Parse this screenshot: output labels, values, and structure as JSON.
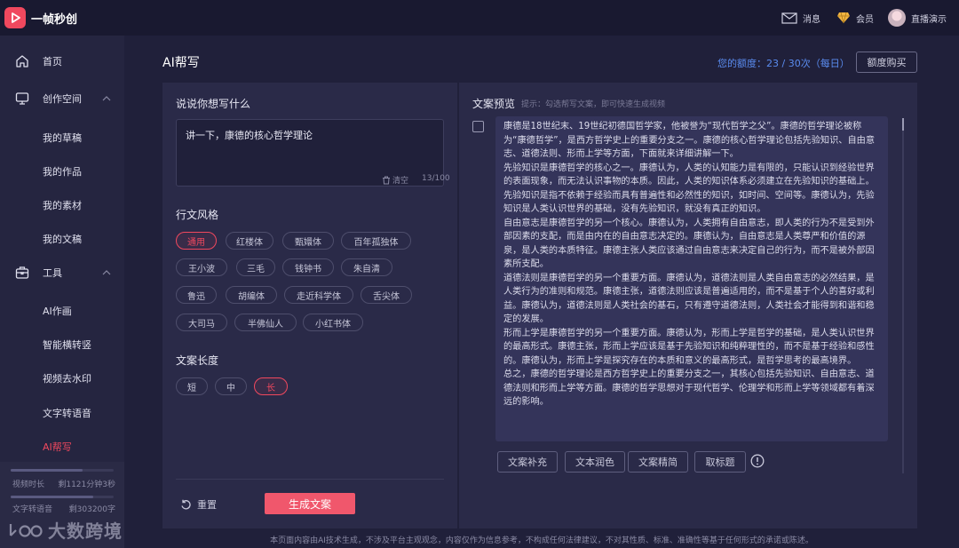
{
  "app": {
    "name": "一帧秒创"
  },
  "topbar": {
    "messages_label": "消息",
    "member_label": "会员",
    "user_name": "直播演示"
  },
  "sidebar": {
    "home": "首页",
    "creation_space": "创作空间",
    "creation_items": [
      "我的草稿",
      "我的作品",
      "我的素材",
      "我的文稿"
    ],
    "tools": "工具",
    "tool_items": [
      "AI作画",
      "智能横转竖",
      "视频去水印",
      "文字转语音",
      "AI帮写"
    ],
    "stats": [
      {
        "label": "视频时长",
        "value": "剩1121分钟3秒"
      },
      {
        "label": "文字转语音",
        "value": "剩303200字"
      }
    ]
  },
  "page": {
    "title": "AI帮写",
    "quota": "您的额度：23 / 30次（每日）",
    "buy_button": "额度购买"
  },
  "form": {
    "prompt_label": "说说你想写什么",
    "prompt_value": "讲一下，康德的核心哲学理论",
    "clear_label": "清空",
    "counter": "13/100",
    "style_label": "行文风格",
    "styles": [
      [
        "通用",
        "红楼体",
        "甄嬛体",
        "百年孤独体"
      ],
      [
        "王小波",
        "三毛",
        "钱钟书",
        "朱自清"
      ],
      [
        "鲁迅",
        "胡编体",
        "走近科学体",
        "舌尖体"
      ],
      [
        "大司马",
        "半佛仙人",
        "小红书体"
      ]
    ],
    "active_style": "通用",
    "length_label": "文案长度",
    "lengths": [
      "短",
      "中",
      "长"
    ],
    "active_length": "长",
    "reset_button": "重置",
    "generate_button": "生成文案"
  },
  "preview": {
    "title": "文案预览",
    "hint": "提示：勾选帮写文案，即可快速生成视频",
    "content": "康德是18世纪末、19世纪初德国哲学家，他被誉为“现代哲学之父”。康德的哲学理论被称为“康德哲学”，是西方哲学史上的重要分支之一。康德的核心哲学理论包括先验知识、自由意志、道德法则、形而上学等方面，下面就来详细讲解一下。\n先验知识是康德哲学的核心之一。康德认为，人类的认知能力是有限的，只能认识到经验世界的表面现象，而无法认识事物的本质。因此，人类的知识体系必须建立在先验知识的基础上。先验知识是指不依赖于经验而具有普遍性和必然性的知识，如时间、空间等。康德认为，先验知识是人类认识世界的基础，没有先验知识，就没有真正的知识。\n自由意志是康德哲学的另一个核心。康德认为，人类拥有自由意志，即人类的行为不是受到外部因素的支配，而是由内在的自由意志决定的。康德认为，自由意志是人类尊严和价值的源泉，是人类的本质特征。康德主张人类应该通过自由意志来决定自己的行为，而不是被外部因素所支配。\n道德法则是康德哲学的另一个重要方面。康德认为，道德法则是人类自由意志的必然结果，是人类行为的准则和规范。康德主张，道德法则应该是普遍适用的，而不是基于个人的喜好或利益。康德认为，道德法则是人类社会的基石，只有遵守道德法则，人类社会才能得到和谐和稳定的发展。\n形而上学是康德哲学的另一个重要方面。康德认为，形而上学是哲学的基础，是人类认识世界的最高形式。康德主张，形而上学应该是基于先验知识和纯粹理性的，而不是基于经验和感性的。康德认为，形而上学是探究存在的本质和意义的最高形式，是哲学思考的最高境界。\n总之，康德的哲学理论是西方哲学史上的重要分支之一，其核心包括先验知识、自由意志、道德法则和形而上学等方面。康德的哲学思想对于现代哲学、伦理学和形而上学等领域都有着深远的影响。",
    "actions": [
      "文案补充",
      "文本润色",
      "文案精简",
      "取标题"
    ]
  },
  "footer": {
    "disclaimer": "本页面内容由AI技术生成，不涉及平台主观观念，内容仅作为信息参考，不构成任何法律建议，不对其性质、标准、准确性等基于任何形式的承诺或陈述。"
  },
  "watermark": {
    "text": "大数跨境"
  },
  "colors": {
    "accent": "#f0485e",
    "quota_blue": "#5a8cf0",
    "background": "#20203a",
    "panel": "#2a2a48"
  }
}
